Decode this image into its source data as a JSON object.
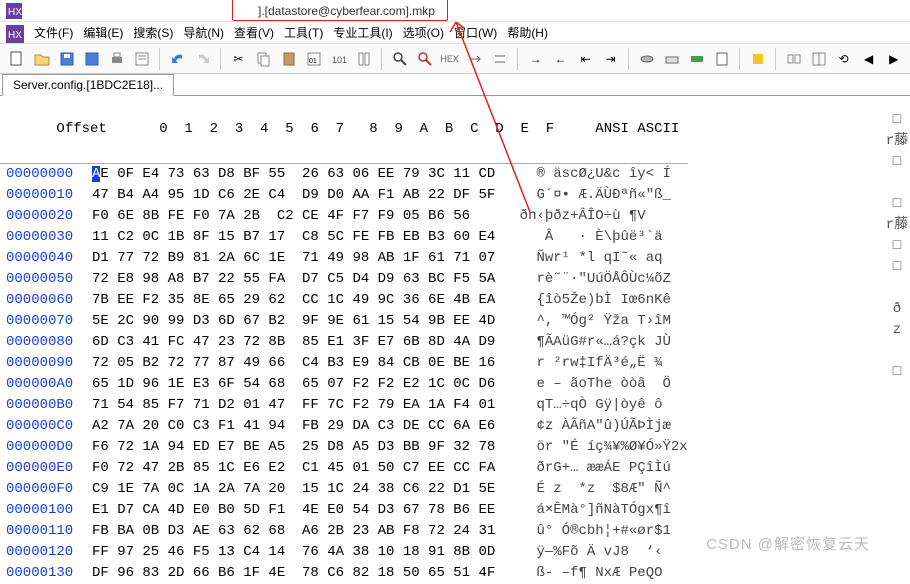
{
  "title_suffix": "].[datastore@cyberfear.com].mkp",
  "menus": [
    "文件(F)",
    "编辑(E)",
    "搜索(S)",
    "导航(N)",
    "查看(V)",
    "工具(T)",
    "专业工具(I)",
    "选项(O)",
    "窗口(W)",
    "帮助(H)"
  ],
  "tab_label": "Server.config.[1BDC2E18]...",
  "hex_header_offset": "Offset",
  "hex_header_cols": "  0  1  2  3  4  5  6  7   8  9  A  B  C  D  E  F",
  "hex_header_ascii": "   ANSI ASCII",
  "rows": [
    {
      "addr": "00000000",
      "hex": "AE 0F E4 73 63 D8 BF 55  26 63 06 EE 79 3C 11 CD",
      "asc": "® äscØ¿U&c îy< Í"
    },
    {
      "addr": "00000010",
      "hex": "47 B4 A4 95 1D C6 2E C4  D9 D0 AA F1 AB 22 DF 5F",
      "asc": "G´¤• Æ.ÄÙÐªñ«\"ß_"
    },
    {
      "addr": "00000020",
      "hex": "F0 6E 8B FE F0 7A 2B  C2 CE 4F F7 F9 05 B6 56",
      "asc": " ðn‹þðz+ÂÎO÷ù ¶V"
    },
    {
      "addr": "00000030",
      "hex": "11 C2 0C 1B 8F 15 B7 17  C8 5C FE FB EB B3 60 E4",
      "asc": " Â   · È\\þûë³`ä"
    },
    {
      "addr": "00000040",
      "hex": "D1 77 72 B9 81 2A 6C 1E  71 49 98 AB 1F 61 71 07",
      "asc": "Ñwr¹ *l qI˜« aq "
    },
    {
      "addr": "00000050",
      "hex": "72 E8 98 A8 B7 22 55 FA  D7 C5 D4 D9 63 BC F5 5A",
      "asc": "rè˜¨·\"UúÖÅÔÙc¼õZ"
    },
    {
      "addr": "00000060",
      "hex": "7B EE F2 35 8E 65 29 62  CC 1C 49 9C 36 6E 4B EA",
      "asc": "{îò5Že)bÌ Iœ6nKê"
    },
    {
      "addr": "00000070",
      "hex": "5E 2C 90 99 D3 6D 67 B2  9F 9E 61 15 54 9B EE 4D",
      "asc": "^, ™Óg² Ÿža T›îM"
    },
    {
      "addr": "00000080",
      "hex": "6D C3 41 FC 47 23 72 8B  85 E1 3F E7 6B 8D 4A D9",
      "asc": "¶ÃAüG#r«…á?çk JÙ"
    },
    {
      "addr": "00000090",
      "hex": "72 05 B2 72 77 87 49 66  C4 B3 E9 84 CB 0E BE 16",
      "asc": "r ²rw‡IfÄ³é„Ë ¾ "
    },
    {
      "addr": "000000A0",
      "hex": "65 1D 96 1E E3 6F 54 68  65 07 F2 F2 E2 1C 0C D6",
      "asc": "e – ãoThe òòâ  Ö"
    },
    {
      "addr": "000000B0",
      "hex": "71 54 85 F7 71 D2 01 47  FF 7C F2 79 EA 1A F4 01",
      "asc": "qT…÷qÒ Gÿ|òyê ô "
    },
    {
      "addr": "000000C0",
      "hex": "A2 7A 20 C0 C3 F1 41 94  FB 29 DA C3 DE CC 6A E6",
      "asc": "¢z ÀÃñA\"û)ÚÃÞÌjæ"
    },
    {
      "addr": "000000D0",
      "hex": "F6 72 1A 94 ED E7 BE A5  25 D8 A5 D3 BB 9F 32 78",
      "asc": "ör \"É íç¾¥%Ø¥Ó»Ÿ2x"
    },
    {
      "addr": "000000E0",
      "hex": "F0 72 47 2B 85 1C E6 E2  C1 45 01 50 C7 EE CC FA",
      "asc": "ðrG+… ææÁE PÇîÌú"
    },
    {
      "addr": "000000F0",
      "hex": "C9 1E 7A 0C 1A 2A 7A 20  15 1C 24 38 C6 22 D1 5E",
      "asc": "É z  *z  $8Æ\" Ñ^"
    },
    {
      "addr": "00000100",
      "hex": "E1 D7 CA 4D E0 B0 5D F1  4E E0 54 D3 67 78 B6 EE",
      "asc": "á×ÊMà°]ñNàTÓgx¶î"
    },
    {
      "addr": "00000110",
      "hex": "FB BA 0B D3 AE 63 62 68  A6 2B 23 AB F8 72 24 31",
      "asc": "û° Ó®cbh¦+#«ør$1"
    },
    {
      "addr": "00000120",
      "hex": "FF 97 25 46 F5 13 C4 14  76 4A 38 10 18 91 8B 0D",
      "asc": "ÿ—%Fõ Ä vJ8  ‘‹ "
    },
    {
      "addr": "00000130",
      "hex": "DF 96 83 2D 66 B6 1F 4E  78 C6 82 18 50 65 51 4F",
      "asc": "ß- –f¶ NxÆ PeQO"
    }
  ],
  "rt_strip": [
    "□",
    "r藤",
    "□",
    "",
    "□",
    "r藤",
    "□",
    "□",
    "",
    "ð",
    "z",
    "",
    "□",
    "",
    "",
    "",
    "",
    "",
    "",
    ""
  ],
  "watermark": "CSDN @解密恢复云天"
}
